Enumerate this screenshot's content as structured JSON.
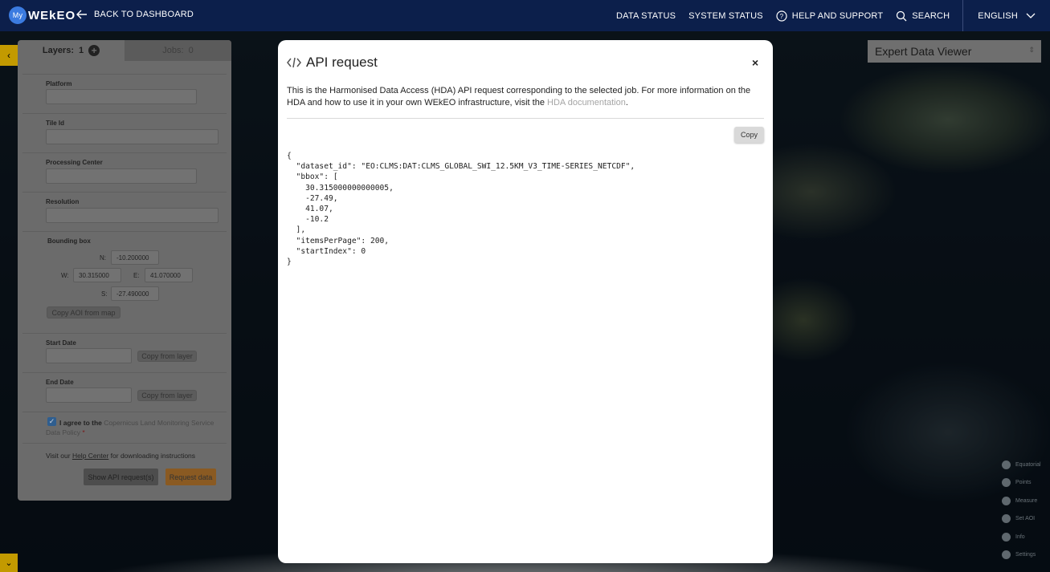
{
  "topbar": {
    "logo_my": "My",
    "logo_text": "WEkEO",
    "back_label": "BACK TO DASHBOARD",
    "nav": [
      "DATA STATUS",
      "SYSTEM STATUS",
      "HELP AND SUPPORT",
      "SEARCH"
    ],
    "language": "ENGLISH"
  },
  "panel": {
    "layers_label": "Layers:",
    "layers_count": "1",
    "jobs_label": "Jobs:",
    "jobs_count": "0",
    "platform_label": "Platform",
    "tile_label": "Tile Id",
    "processing_label": "Processing Center",
    "resolution_label": "Resolution",
    "bbox_label": "Bounding box",
    "n_label": "N:",
    "n_value": "-10.200000",
    "w_label": "W:",
    "w_value": "30.315000",
    "e_label": "E:",
    "e_value": "41.070000",
    "s_label": "S:",
    "s_value": "-27.490000",
    "copy_aoi": "Copy AOI from map",
    "start_label": "Start Date",
    "end_label": "End Date",
    "copy_from_layer": "Copy from layer",
    "agree_text": "I agree to the",
    "agree_link": "Copernicus Land Monitoring Service Data Policy",
    "agree_star": "*",
    "help_prefix": "Visit our",
    "help_link": "Help Center",
    "help_suffix": "for downloading instructions",
    "show_api": "Show API request(s)",
    "request_data": "Request data"
  },
  "viewer": {
    "label": "Expert Data Viewer"
  },
  "tools": [
    "Equatorial",
    "Points",
    "Measure",
    "Set AOI",
    "Info",
    "Settings"
  ],
  "modal": {
    "title": "API request",
    "close": "×",
    "desc_text": "This is the Harmonised Data Access (HDA) API request corresponding to the selected job. For more information on the HDA and how to use it in your own WEkEO infrastructure, visit the",
    "desc_link": "HDA documentation",
    "desc_end": ".",
    "copy_label": "Copy",
    "code": "{\n  \"dataset_id\": \"EO:CLMS:DAT:CLMS_GLOBAL_SWI_12.5KM_V3_TIME-SERIES_NETCDF\",\n  \"bbox\": [\n    30.315000000000005,\n    -27.49,\n    41.07,\n    -10.2\n  ],\n  \"itemsPerPage\": 200,\n  \"startIndex\": 0\n}"
  }
}
